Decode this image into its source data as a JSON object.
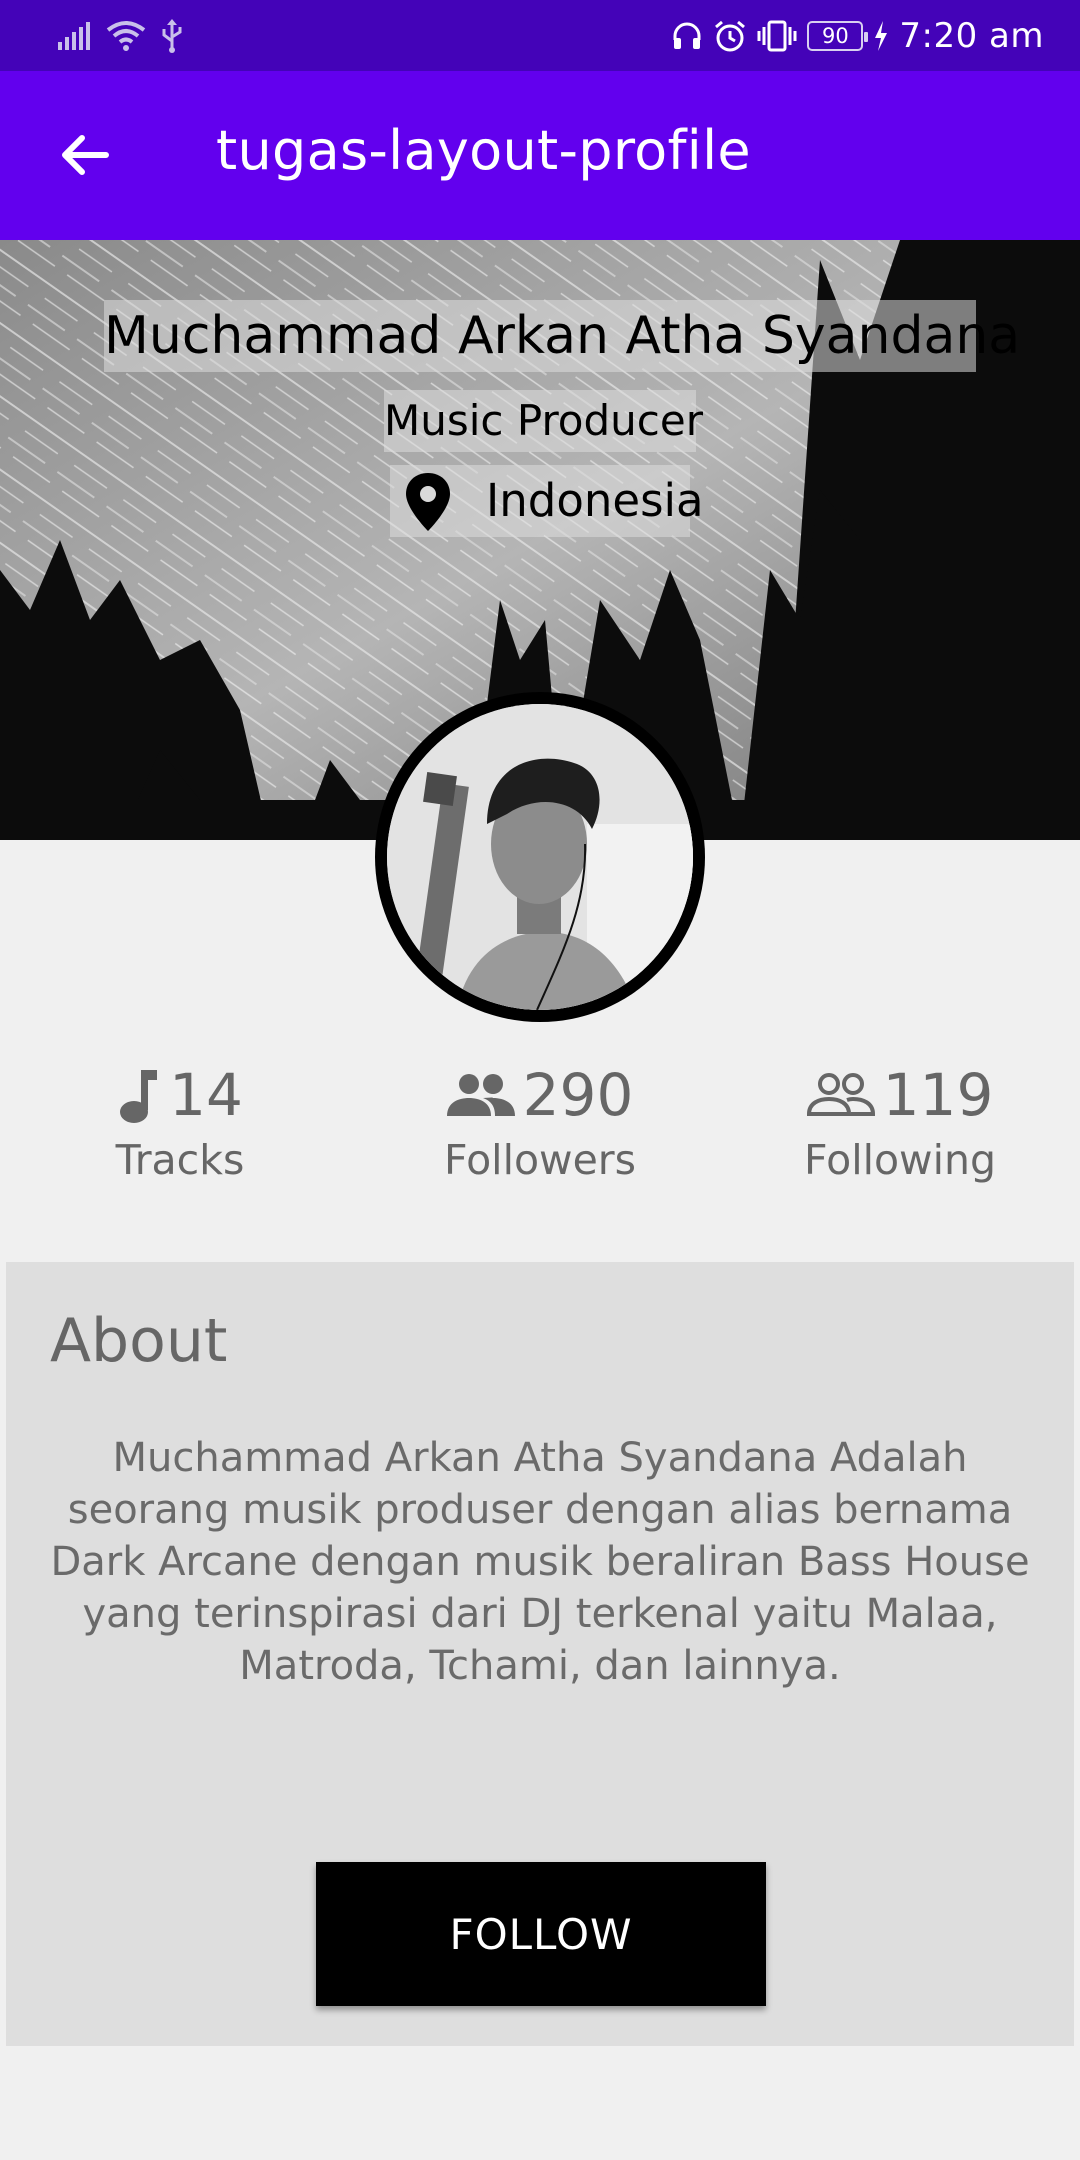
{
  "status_bar": {
    "battery": "90",
    "time": "7:20 am",
    "icons": [
      "signal-icon",
      "wifi-icon",
      "usb-icon",
      "headphones-icon",
      "alarm-icon",
      "vibrate-icon",
      "battery-icon",
      "charging-icon"
    ]
  },
  "app_bar": {
    "title": "tugas-layout-profile",
    "back_icon": "arrow-left-icon",
    "color": "#6200ee"
  },
  "profile": {
    "name": "Muchammad Arkan Atha Syandana",
    "role": "Music Producer",
    "location": "Indonesia",
    "location_icon": "map-pin-icon"
  },
  "stats": [
    {
      "icon": "music-note-icon",
      "value": "14",
      "label": "Tracks"
    },
    {
      "icon": "people-icon",
      "value": "290",
      "label": "Followers"
    },
    {
      "icon": "people-outline-icon",
      "value": "119",
      "label": "Following"
    }
  ],
  "about": {
    "title": "About",
    "text": "Muchammad Arkan Atha Syandana Adalah seorang musik produser dengan alias bernama Dark Arcane dengan musik beraliran Bass House yang terinspirasi dari DJ terkenal yaitu Malaa, Matroda, Tchami, dan lainnya."
  },
  "follow_button": {
    "label": "FOLLOW"
  },
  "colors": {
    "status_bar": "#4403b8",
    "app_bar": "#6200ee",
    "button": "#000000",
    "card": "#dedede",
    "background": "#f0f0f0"
  }
}
